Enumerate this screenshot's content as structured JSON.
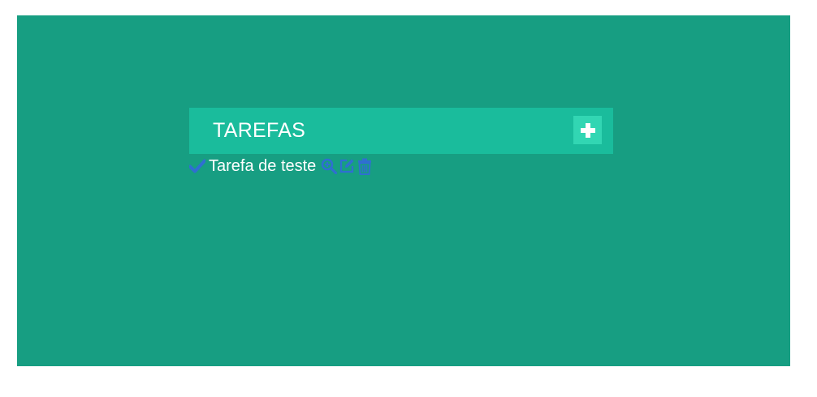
{
  "header": {
    "title": "TAREFAS",
    "add_icon": "plus-icon"
  },
  "tasks": [
    {
      "label": "Tarefa de teste",
      "status_icon": "check-icon",
      "actions": [
        "zoom-icon",
        "edit-icon",
        "trash-icon"
      ]
    }
  ],
  "colors": {
    "page_background": "#ffffff",
    "panel_background": "#179e82",
    "header_background": "#1abc9c",
    "add_button_background": "#32d6b3",
    "icon_blue": "#2f6fd1",
    "text": "#ffffff"
  }
}
